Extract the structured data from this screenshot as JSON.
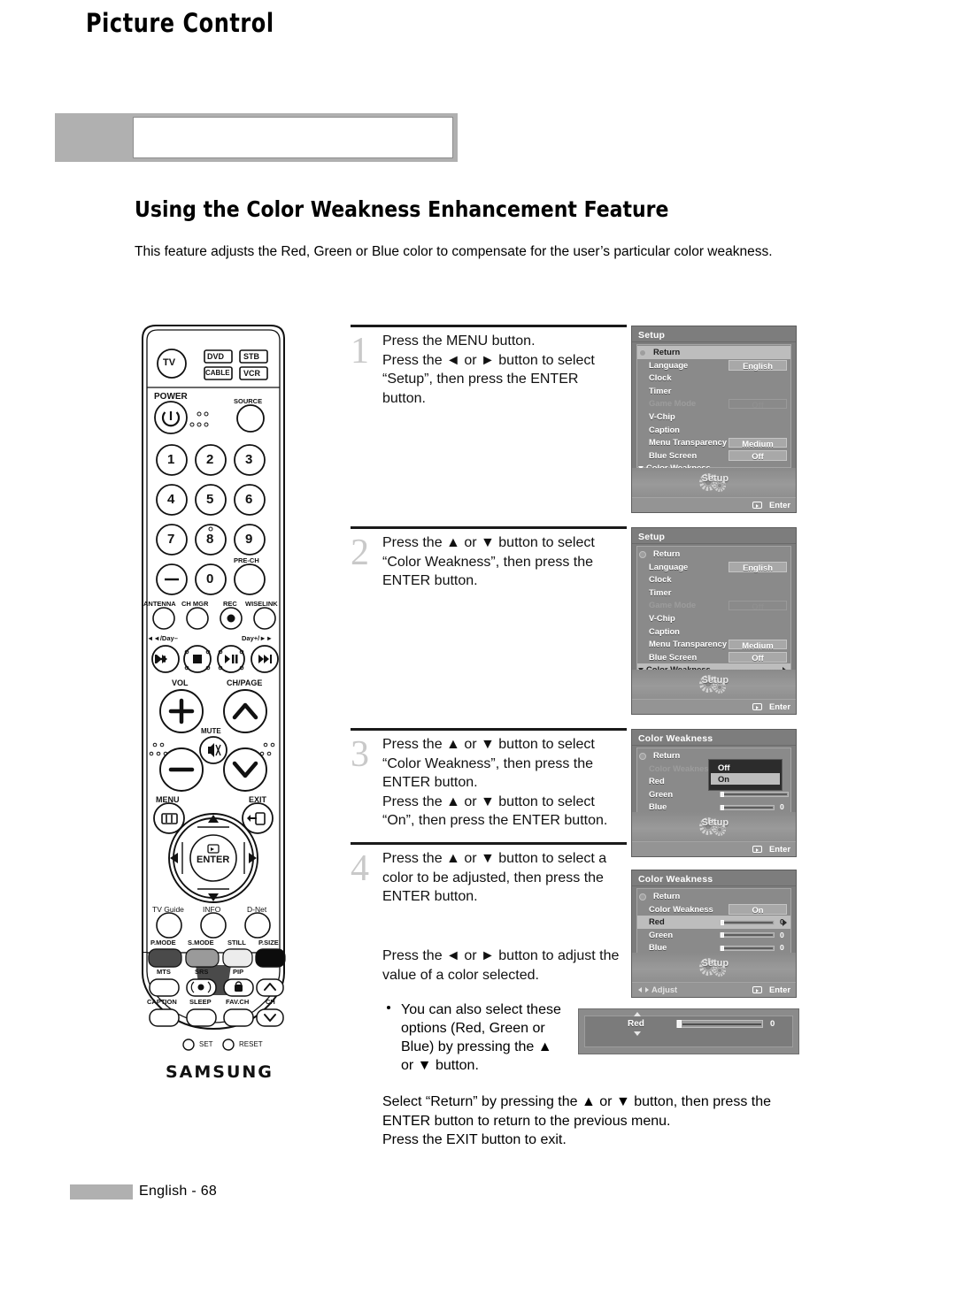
{
  "page": {
    "chapter": "Picture Control",
    "section_title": "Using the Color Weakness Enhancement Feature",
    "intro": "This feature adjusts the Red, Green or Blue color to compensate for the user’s particular color weakness.",
    "footer": "English - 68"
  },
  "steps": [
    {
      "number": "1",
      "lines": [
        "Press the MENU button.",
        "Press the ◄ or ► button to select",
        "“Setup”, then press the ENTER",
        "button."
      ]
    },
    {
      "number": "2",
      "lines": [
        "Press the ▲ or ▼ button to select",
        "“Color Weakness”, then press the",
        "ENTER button."
      ]
    },
    {
      "number": "3",
      "lines": [
        "Press the ▲ or ▼ button to select",
        "“Color Weakness”, then press the",
        "ENTER button.",
        "Press the ▲ or ▼ button to select",
        "“On”, then press the ENTER button."
      ]
    },
    {
      "number": "4",
      "lines": [
        "Press the ▲ or ▼ button to select a",
        "color to be adjusted, then press the",
        "ENTER button."
      ],
      "lines2": [
        "Press the ◄ or ► button to adjust the",
        "value of a color selected."
      ],
      "bullet": [
        "You can also select these",
        "options (Red, Green or",
        "Blue) by pressing the ▲",
        "or ▼ button."
      ]
    }
  ],
  "closing": [
    "Select “Return” by pressing the ▲ or ▼ button, then press the",
    "ENTER button to return to the previous menu.",
    "Press the EXIT button to exit."
  ],
  "osd": {
    "setup_title": "Setup",
    "color_weakness_title": "Color Weakness",
    "gear_label": "Setup",
    "enter_label": "Enter",
    "adjust_label": "Adjust",
    "panel1": {
      "title": "Setup",
      "rows": [
        {
          "label": "Return",
          "value": "",
          "state": "highlight-soft"
        },
        {
          "label": "Language",
          "value": "English",
          "state": "normal"
        },
        {
          "label": "Clock",
          "value": "",
          "state": "normal"
        },
        {
          "label": "Timer",
          "value": "",
          "state": "normal"
        },
        {
          "label": "Game Mode",
          "value": "Off",
          "state": "disabled"
        },
        {
          "label": "V-Chip",
          "value": "",
          "state": "normal"
        },
        {
          "label": "Caption",
          "value": "",
          "state": "normal"
        },
        {
          "label": "Menu Transparency",
          "value": "Medium",
          "state": "normal"
        },
        {
          "label": "Blue Screen",
          "value": "Off",
          "state": "normal"
        },
        {
          "label": "Color Weakness",
          "value": "",
          "state": "normal"
        }
      ]
    },
    "panel2": {
      "title": "Setup",
      "rows": [
        {
          "label": "Return",
          "value": "",
          "state": "normal"
        },
        {
          "label": "Language",
          "value": "English",
          "state": "normal"
        },
        {
          "label": "Clock",
          "value": "",
          "state": "normal"
        },
        {
          "label": "Timer",
          "value": "",
          "state": "normal"
        },
        {
          "label": "Game Mode",
          "value": "Off",
          "state": "disabled"
        },
        {
          "label": "V-Chip",
          "value": "",
          "state": "normal"
        },
        {
          "label": "Caption",
          "value": "",
          "state": "normal"
        },
        {
          "label": "Menu Transparency",
          "value": "Medium",
          "state": "normal"
        },
        {
          "label": "Blue Screen",
          "value": "Off",
          "state": "normal"
        },
        {
          "label": "Color Weakness",
          "value": "",
          "state": "selected"
        }
      ]
    },
    "panel3": {
      "title": "Color Weakness",
      "rows": [
        {
          "label": "Return",
          "value": "",
          "state": "normal"
        },
        {
          "label": "Color Weakness",
          "value": "",
          "state": "disabled"
        },
        {
          "label": "Red",
          "value": "0",
          "state": "normal"
        },
        {
          "label": "Green",
          "value": "0",
          "state": "normal"
        },
        {
          "label": "Blue",
          "value": "0",
          "state": "normal"
        }
      ],
      "dropdown": {
        "options": [
          "Off",
          "On"
        ],
        "selected": "On"
      }
    },
    "panel4": {
      "title": "Color Weakness",
      "rows": [
        {
          "label": "Return",
          "value": "",
          "state": "normal"
        },
        {
          "label": "Color Weakness",
          "value": "On",
          "state": "normal"
        },
        {
          "label": "Red",
          "value": "0",
          "state": "selected"
        },
        {
          "label": "Green",
          "value": "0",
          "state": "normal"
        },
        {
          "label": "Blue",
          "value": "0",
          "state": "normal"
        }
      ]
    }
  },
  "red_widget": {
    "label": "Red",
    "value": "0"
  },
  "remote": {
    "brand": "SAMSUNG",
    "tvguide_line1": "TV",
    "tvguide_line2": "GUIDE",
    "mode_tv": "TV",
    "mode_dvd": "DVD",
    "mode_stb": "STB",
    "mode_cable": "CABLE",
    "mode_vcr": "VCR",
    "power": "POWER",
    "source": "SOURCE",
    "keys": [
      "1",
      "2",
      "3",
      "4",
      "5",
      "6",
      "7",
      "8",
      "9",
      "0"
    ],
    "pre_ch": "PRE-CH",
    "antenna": "ANTENNA",
    "ch_mgr": "CH MGR",
    "rec": "REC",
    "wiselink": "WISELINK",
    "day_minus": "◄◄/Day–",
    "day_plus": "Day+/►►",
    "vol": "VOL",
    "ch_page": "CH/PAGE",
    "mute": "MUTE",
    "menu": "MENU",
    "exit": "EXIT",
    "enter": "ENTER",
    "tv_guide": "TV Guide",
    "info": "INFO",
    "dnet": "D-Net",
    "p_mode": "P.MODE",
    "s_mode": "S.MODE",
    "still": "STILL",
    "p_size": "P.SIZE",
    "mts": "MTS",
    "srs": "SRS",
    "pip": "PIP",
    "ch": "CH",
    "caption": "CAPTION",
    "sleep": "SLEEP",
    "fav_ch": "FAV.CH",
    "set": "SET",
    "reset": "RESET"
  },
  "colors": {
    "header_grey": "#b0b0b0",
    "osd_bg": "#7d7d7d",
    "osd_list": "#8a8a8a",
    "osd_highlight": "#bdbdbd",
    "step_number": "#c9c9c9",
    "text": "#111111"
  }
}
